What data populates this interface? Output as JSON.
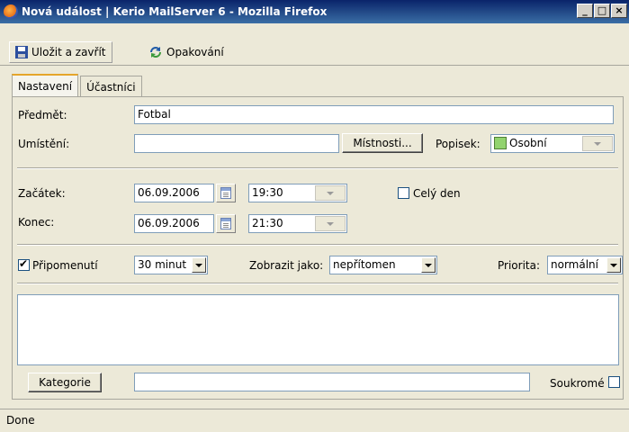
{
  "window": {
    "title": "Nová událost | Kerio MailServer 6 - Mozilla Firefox",
    "controls": {
      "minimize": "_",
      "maximize": "□",
      "close": "×"
    }
  },
  "toolbar": {
    "save_close_label": "Uložit a zavřít",
    "repeat_label": "Opakování"
  },
  "tabs": [
    {
      "label": "Nastavení",
      "active": true
    },
    {
      "label": "Účastníci",
      "active": false
    }
  ],
  "form": {
    "subject_label": "Předmět:",
    "subject_value": "Fotbal",
    "location_label": "Umístění:",
    "location_value": "",
    "rooms_button": "Místnosti...",
    "tag_label": "Popisek:",
    "tag_value": "Osobní",
    "tag_color": "#92d36e",
    "start_label": "Začátek:",
    "start_date": "06.09.2006",
    "start_time": "19:30",
    "all_day_label": "Celý den",
    "all_day_checked": false,
    "end_label": "Konec:",
    "end_date": "06.09.2006",
    "end_time": "21:30",
    "reminder_label": "Připomenutí",
    "reminder_checked": true,
    "reminder_value": "30 minut",
    "show_as_label": "Zobrazit jako:",
    "show_as_value": "nepřítomen",
    "priority_label": "Priorita:",
    "priority_value": "normální",
    "description_value": "",
    "category_button": "Kategorie",
    "category_value": "",
    "private_label": "Soukromé",
    "private_checked": false
  },
  "status": {
    "text": "Done"
  },
  "colors": {
    "accent_tab": "#e5a52a",
    "titlebar_start": "#0a246a",
    "titlebar_end": "#3a6ea5",
    "input_border": "#7f9db9"
  }
}
